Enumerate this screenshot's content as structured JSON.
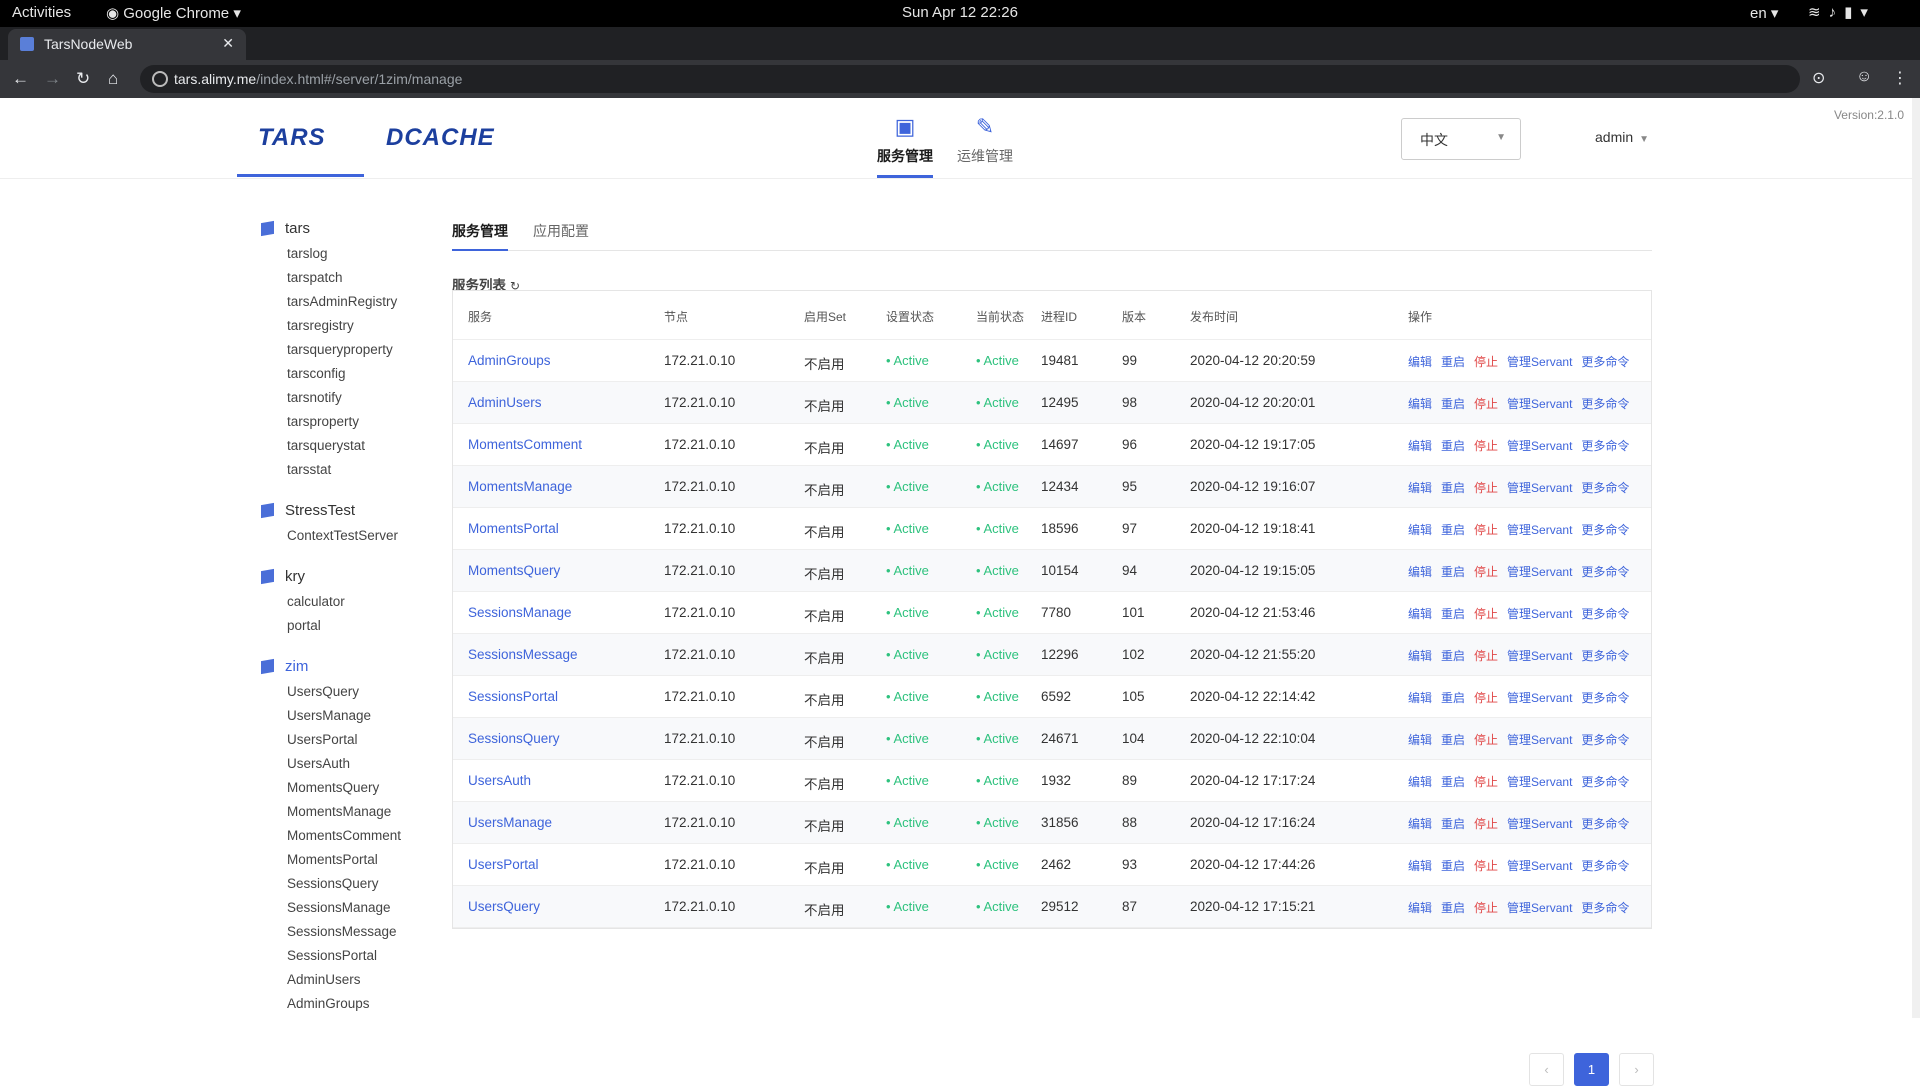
{
  "system": {
    "activities": "Activities",
    "app": "Google Chrome",
    "clock": "Sun Apr 12  22:26",
    "lang": "en"
  },
  "browser": {
    "tab_title": "TarsNodeWeb",
    "url_host": "tars.alimy.me",
    "url_path": "/index.html#/server/1zim/manage"
  },
  "header": {
    "version": "Version:2.1.0",
    "logo_tars": "TARS",
    "logo_dcache": "DCACHE",
    "nav": [
      "服务管理",
      "运维管理"
    ],
    "lang_select": "中文",
    "user": "admin"
  },
  "sidebar": {
    "groups": [
      {
        "name": "tars",
        "items": [
          "tarslog",
          "tarspatch",
          "tarsAdminRegistry",
          "tarsregistry",
          "tarsqueryproperty",
          "tarsconfig",
          "tarsnotify",
          "tarsproperty",
          "tarsquerystat",
          "tarsstat"
        ]
      },
      {
        "name": "StressTest",
        "items": [
          "ContextTestServer"
        ]
      },
      {
        "name": "kry",
        "items": [
          "calculator",
          "portal"
        ]
      },
      {
        "name": "zim",
        "items": [
          "UsersQuery",
          "UsersManage",
          "UsersPortal",
          "UsersAuth",
          "MomentsQuery",
          "MomentsManage",
          "MomentsComment",
          "MomentsPortal",
          "SessionsQuery",
          "SessionsManage",
          "SessionsMessage",
          "SessionsPortal",
          "AdminUsers",
          "AdminGroups"
        ]
      }
    ]
  },
  "main": {
    "tabs": [
      "服务管理",
      "应用配置"
    ],
    "list_title": "服务列表",
    "columns": [
      "服务",
      "节点",
      "启用Set",
      "设置状态",
      "当前状态",
      "进程ID",
      "版本",
      "发布时间",
      "操作"
    ],
    "actions": [
      "编辑",
      "重启",
      "停止",
      "管理Servant",
      "更多命令"
    ],
    "rows": [
      [
        "AdminGroups",
        "172.21.0.10",
        "不启用",
        "• Active",
        "• Active",
        "19481",
        "99",
        "2020-04-12 20:20:59"
      ],
      [
        "AdminUsers",
        "172.21.0.10",
        "不启用",
        "• Active",
        "• Active",
        "12495",
        "98",
        "2020-04-12 20:20:01"
      ],
      [
        "MomentsComment",
        "172.21.0.10",
        "不启用",
        "• Active",
        "• Active",
        "14697",
        "96",
        "2020-04-12 19:17:05"
      ],
      [
        "MomentsManage",
        "172.21.0.10",
        "不启用",
        "• Active",
        "• Active",
        "12434",
        "95",
        "2020-04-12 19:16:07"
      ],
      [
        "MomentsPortal",
        "172.21.0.10",
        "不启用",
        "• Active",
        "• Active",
        "18596",
        "97",
        "2020-04-12 19:18:41"
      ],
      [
        "MomentsQuery",
        "172.21.0.10",
        "不启用",
        "• Active",
        "• Active",
        "10154",
        "94",
        "2020-04-12 19:15:05"
      ],
      [
        "SessionsManage",
        "172.21.0.10",
        "不启用",
        "• Active",
        "• Active",
        "7780",
        "101",
        "2020-04-12 21:53:46"
      ],
      [
        "SessionsMessage",
        "172.21.0.10",
        "不启用",
        "• Active",
        "• Active",
        "12296",
        "102",
        "2020-04-12 21:55:20"
      ],
      [
        "SessionsPortal",
        "172.21.0.10",
        "不启用",
        "• Active",
        "• Active",
        "6592",
        "105",
        "2020-04-12 22:14:42"
      ],
      [
        "SessionsQuery",
        "172.21.0.10",
        "不启用",
        "• Active",
        "• Active",
        "24671",
        "104",
        "2020-04-12 22:10:04"
      ],
      [
        "UsersAuth",
        "172.21.0.10",
        "不启用",
        "• Active",
        "• Active",
        "1932",
        "89",
        "2020-04-12 17:17:24"
      ],
      [
        "UsersManage",
        "172.21.0.10",
        "不启用",
        "• Active",
        "• Active",
        "31856",
        "88",
        "2020-04-12 17:16:24"
      ],
      [
        "UsersPortal",
        "172.21.0.10",
        "不启用",
        "• Active",
        "• Active",
        "2462",
        "93",
        "2020-04-12 17:44:26"
      ],
      [
        "UsersQuery",
        "172.21.0.10",
        "不启用",
        "• Active",
        "• Active",
        "29512",
        "87",
        "2020-04-12 17:15:21"
      ]
    ],
    "pagination": {
      "prev": "‹",
      "current": "1",
      "next": "›"
    }
  },
  "colors": {
    "accent": "#3e64db",
    "active": "#2ec27e",
    "stop": "#e04848"
  }
}
